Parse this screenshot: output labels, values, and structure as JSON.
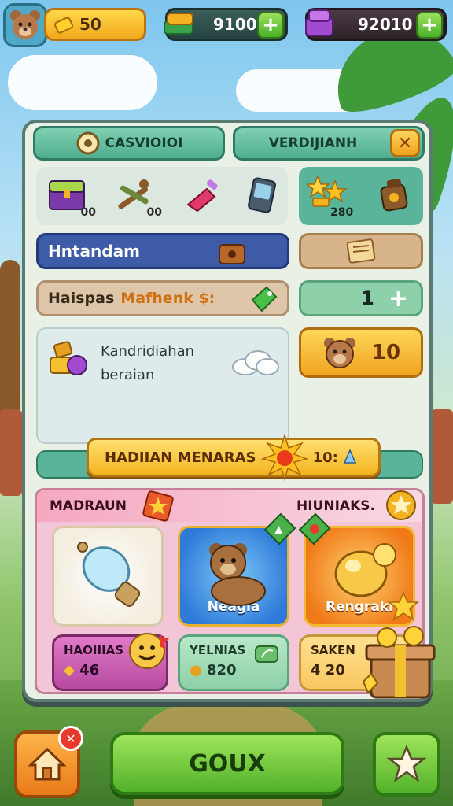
{
  "top_bar": {
    "gold_amount": "50",
    "cash_amount": "9100",
    "gem_amount": "92010",
    "add_symbol": "+"
  },
  "panel": {
    "tab_left_label": "CASVIOIOI",
    "tab_right_label": "VERDIJIANH",
    "close_symbol": "✕",
    "inventory": {
      "slot1_qty": "00",
      "slot2_qty": "00",
      "reward_qty": "280"
    },
    "row_primary_label": "Hntandam",
    "row_secondary_label_a": "Haispas",
    "row_secondary_label_b": "Mafhenk $:",
    "counter_value": "1",
    "counter_plus": "+",
    "info_line1": "Kandridiahan",
    "info_line2": "beraian",
    "bear_reward_value": "10",
    "banner_label": "HADIIAN MENARAS",
    "banner_suffix": "10:",
    "section_left_title": "MADRAUN",
    "section_right_title": "HIUNIAKS.",
    "cards": [
      {
        "label": ""
      },
      {
        "label": "Neagla"
      },
      {
        "label": "Rengraki"
      }
    ],
    "stats": [
      {
        "label": "HAOIIIAS",
        "value": "46"
      },
      {
        "label": "YELNIAS",
        "value": "820"
      },
      {
        "label": "SAKEN",
        "value": "4 20"
      }
    ]
  },
  "bottom": {
    "main_button_label": "GOUX",
    "home_badge_symbol": "✕"
  },
  "colors": {
    "accent_green": "#52b22a",
    "accent_gold": "#f4b320",
    "panel_bg": "#e9f0e6"
  }
}
